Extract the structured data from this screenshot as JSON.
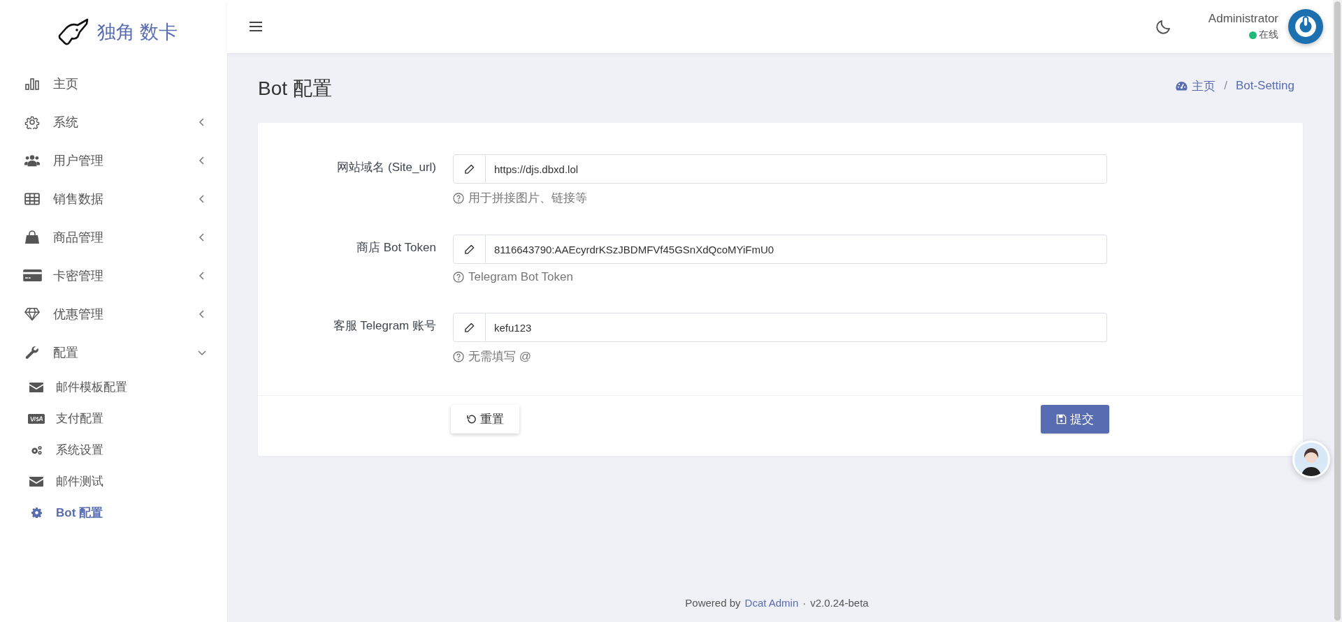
{
  "brand": {
    "name": "独角 数卡"
  },
  "sidebar": {
    "items": [
      {
        "label": "主页",
        "kind": "link"
      },
      {
        "label": "系统",
        "kind": "group",
        "expanded": false
      },
      {
        "label": "用户管理",
        "kind": "group",
        "expanded": false
      },
      {
        "label": "销售数据",
        "kind": "group",
        "expanded": false
      },
      {
        "label": "商品管理",
        "kind": "group",
        "expanded": false
      },
      {
        "label": "卡密管理",
        "kind": "group",
        "expanded": false
      },
      {
        "label": "优惠管理",
        "kind": "group",
        "expanded": false
      },
      {
        "label": "配置",
        "kind": "group",
        "expanded": true,
        "children": [
          {
            "label": "邮件模板配置",
            "selected": false
          },
          {
            "label": "支付配置",
            "selected": false
          },
          {
            "label": "系统设置",
            "selected": false
          },
          {
            "label": "邮件测试",
            "selected": false
          },
          {
            "label": "Bot 配置",
            "selected": true
          }
        ]
      }
    ]
  },
  "header": {
    "user": {
      "name": "Administrator",
      "status": "在线"
    }
  },
  "page": {
    "title": "Bot 配置",
    "breadcrumb": [
      "主页",
      "Bot-Setting"
    ],
    "breadcrumb_separator": "/"
  },
  "form": {
    "fields": [
      {
        "label": "网站域名 (Site_url)",
        "value": "https://djs.dbxd.lol",
        "help": "用于拼接图片、链接等"
      },
      {
        "label": "商店 Bot Token",
        "value": "8116643790:AAEcyrdrKSzJBDMFVf45GSnXdQcoMYiFmU0",
        "help": "Telegram Bot Token"
      },
      {
        "label": "客服 Telegram 账号",
        "value": "kefu123",
        "help": "无需填写 @"
      }
    ],
    "buttons": [
      {
        "label": "重置",
        "kind": "reset"
      },
      {
        "label": "提交",
        "kind": "submit"
      }
    ]
  },
  "footer": {
    "prefix": "Powered by",
    "link": "Dcat Admin",
    "separator": "·",
    "version": "v2.0.24-beta"
  }
}
